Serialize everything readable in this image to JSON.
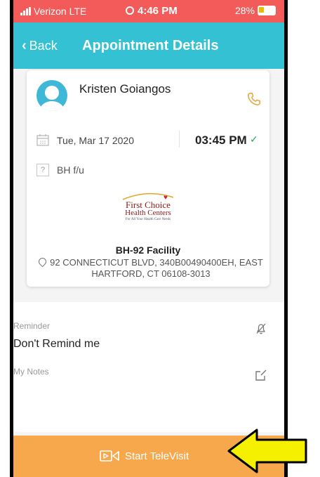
{
  "status_bar": {
    "carrier": "Verizon  LTE",
    "time": "4:46 PM",
    "battery": "28%"
  },
  "nav": {
    "back_label": "Back",
    "title": "Appointment Details"
  },
  "appointment": {
    "patient_name": "Kristen Goiangos",
    "date": "Tue, Mar 17  2020",
    "time": "03:45 PM",
    "reason": "BH f/u",
    "logo": {
      "line1": "First Choice",
      "line2": "Health Centers",
      "line3": "For All Your Health Care Needs"
    },
    "facility": "BH-92 Facility",
    "address": "92 CONNECTICUT BLVD, 340B00490400EH, EAST HARTFORD, CT 06108-3013"
  },
  "reminder": {
    "label": "Reminder",
    "value": "Don't Remind me"
  },
  "notes": {
    "label": "My Notes"
  },
  "cta": {
    "label": "Start TeleVisit"
  },
  "colors": {
    "accent": "#33c1d3",
    "status_bar": "#f35b5b",
    "cta": "#f8a84c",
    "callout_arrow": "#f5f000",
    "check": "#2aaa5a"
  }
}
